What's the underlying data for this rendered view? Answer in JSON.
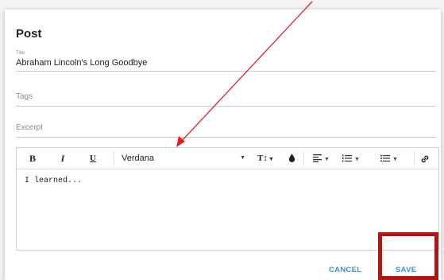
{
  "dialog": {
    "title": "Post",
    "title_field": {
      "label": "Title",
      "value": "Abraham Lincoln's Long Goodbye"
    },
    "tags_field": {
      "placeholder": "Tags"
    },
    "excerpt_field": {
      "placeholder": "Excerpt"
    }
  },
  "editor": {
    "toolbar": {
      "bold": "B",
      "italic": "I",
      "underline": "U",
      "font": "Verdana",
      "font_size_icon": "T↕",
      "caret": "▼",
      "color_icon": "droplet-icon",
      "align_icon": "align-left-icon",
      "ordered_list_icon": "ordered-list-icon",
      "unordered_list_icon": "unordered-list-icon",
      "link_icon": "link-icon"
    },
    "content": "I learned..."
  },
  "actions": {
    "cancel": "CANCEL",
    "save": "SAVE"
  },
  "annotations": {
    "arrow_color": "#e02020",
    "box_color": "#b01515"
  },
  "colors": {
    "accent": "#3b8fd6"
  }
}
